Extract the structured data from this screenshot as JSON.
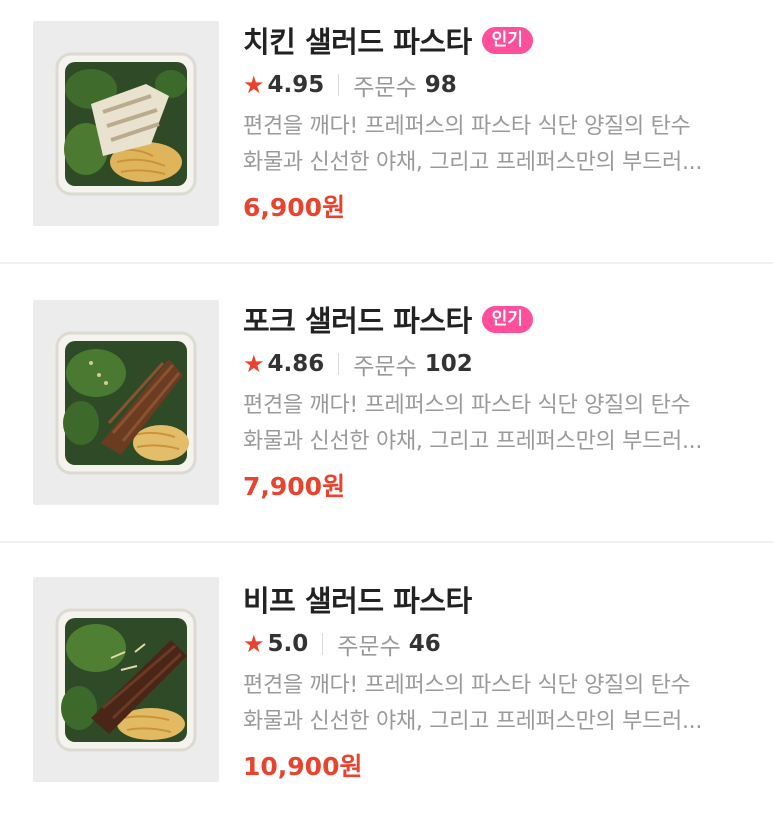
{
  "items": [
    {
      "name": "치킨 샐러드 파스타",
      "badge": "인기",
      "rating": "4.95",
      "orders_label": "주문수",
      "orders": "98",
      "desc_line1": "편견을 깨다! 프레퍼스의 파스타 식단 양질의 탄수",
      "desc_line2": "화물과 신선한 야채, 그리고 프레퍼스만의 부드러...",
      "price": "6,900원",
      "image": "chicken-salad-pasta-photo"
    },
    {
      "name": "포크 샐러드 파스타",
      "badge": "인기",
      "rating": "4.86",
      "orders_label": "주문수",
      "orders": "102",
      "desc_line1": "편견을 깨다! 프레퍼스의 파스타 식단 양질의 탄수",
      "desc_line2": "화물과 신선한 야채, 그리고 프레퍼스만의 부드러...",
      "price": "7,900원",
      "image": "pork-salad-pasta-photo"
    },
    {
      "name": "비프 샐러드 파스타",
      "badge": "",
      "rating": "5.0",
      "orders_label": "주문수",
      "orders": "46",
      "desc_line1": "편견을 깨다! 프레퍼스의 파스타 식단 양질의 탄수",
      "desc_line2": "화물과 신선한 야채, 그리고 프레퍼스만의 부드러...",
      "price": "10,900원",
      "image": "beef-salad-pasta-photo"
    }
  ],
  "colors": {
    "accent": "#e8432e",
    "badge": "#ff4f9a"
  }
}
